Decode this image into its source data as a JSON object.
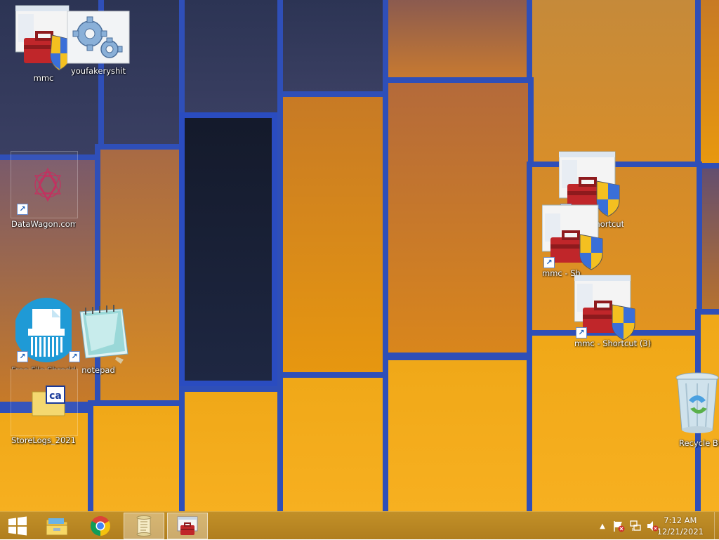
{
  "desktop": {
    "icons": {
      "mmc": "mmc",
      "youfakeryshit": "youfakeryshit",
      "datawagon": "DataWagon.com",
      "shredder": "Free File Shredder",
      "notepad": "notepad",
      "storelogs": "StoreLogs_2021-...",
      "mmc_shortcut": "mmc - Shortcut",
      "mmc_shortcut2": "mmc - Sh",
      "mmc_shortcut3": "mmc - Shortcut (3)",
      "recycle_bin": "Recycle Bin"
    }
  },
  "taskbar": {
    "clock_time": "7:12 AM",
    "clock_date": "12/21/2021",
    "pinned": [
      "start-button",
      "file-explorer",
      "chrome",
      "notepad",
      "mmc"
    ],
    "active": "mmc"
  },
  "colors": {
    "taskbar": "#b88524",
    "frame_blue": "#2f4fb8",
    "accent_orange": "#f2a215"
  }
}
